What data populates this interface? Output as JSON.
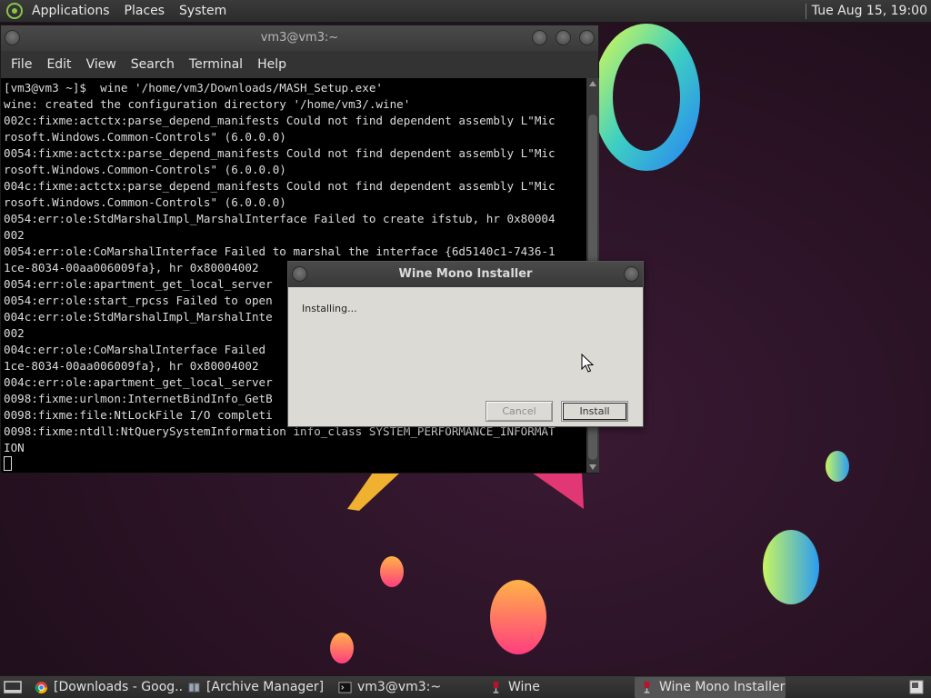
{
  "top_panel": {
    "menus": [
      "Applications",
      "Places",
      "System"
    ],
    "clock": "Tue Aug 15, 19:00"
  },
  "terminal": {
    "title": "vm3@vm3:~",
    "menus": [
      "File",
      "Edit",
      "View",
      "Search",
      "Terminal",
      "Help"
    ],
    "lines": [
      "[vm3@vm3 ~]$  wine '/home/vm3/Downloads/MASH_Setup.exe'",
      "wine: created the configuration directory '/home/vm3/.wine'",
      "002c:fixme:actctx:parse_depend_manifests Could not find dependent assembly L\"Mic",
      "rosoft.Windows.Common-Controls\" (6.0.0.0)",
      "0054:fixme:actctx:parse_depend_manifests Could not find dependent assembly L\"Mic",
      "rosoft.Windows.Common-Controls\" (6.0.0.0)",
      "004c:fixme:actctx:parse_depend_manifests Could not find dependent assembly L\"Mic",
      "rosoft.Windows.Common-Controls\" (6.0.0.0)",
      "0054:err:ole:StdMarshalImpl_MarshalInterface Failed to create ifstub, hr 0x80004",
      "002",
      "0054:err:ole:CoMarshalInterface Failed to marshal the interface {6d5140c1-7436-1",
      "1ce-8034-00aa006009fa}, hr 0x80004002",
      "0054:err:ole:apartment_get_local_server",
      "0054:err:ole:start_rpcss Failed to open",
      "004c:err:ole:StdMarshalImpl_MarshalInte",
      "002",
      "004c:err:ole:CoMarshalInterface Failed",
      "1ce-8034-00aa006009fa}, hr 0x80004002",
      "004c:err:ole:apartment_get_local_server",
      "0098:fixme:urlmon:InternetBindInfo_GetB",
      "0098:fixme:file:NtLockFile I/O completi",
      "0098:fixme:ntdll:NtQuerySystemInformation info_class SYSTEM_PERFORMANCE_INFORMAT",
      "ION"
    ]
  },
  "dialog": {
    "title": "Wine Mono Installer",
    "status": "Installing...",
    "cancel_label": "Cancel",
    "install_label": "Install"
  },
  "taskbar": {
    "tasks": [
      {
        "label": "[Downloads - Goog...",
        "icon": "chrome-icon"
      },
      {
        "label": "[Archive Manager]",
        "icon": "archive-icon"
      },
      {
        "label": "vm3@vm3:~",
        "icon": "terminal-icon"
      },
      {
        "label": "Wine",
        "icon": "wine-icon"
      },
      {
        "label": "Wine Mono Installer",
        "icon": "wine-icon"
      }
    ]
  }
}
